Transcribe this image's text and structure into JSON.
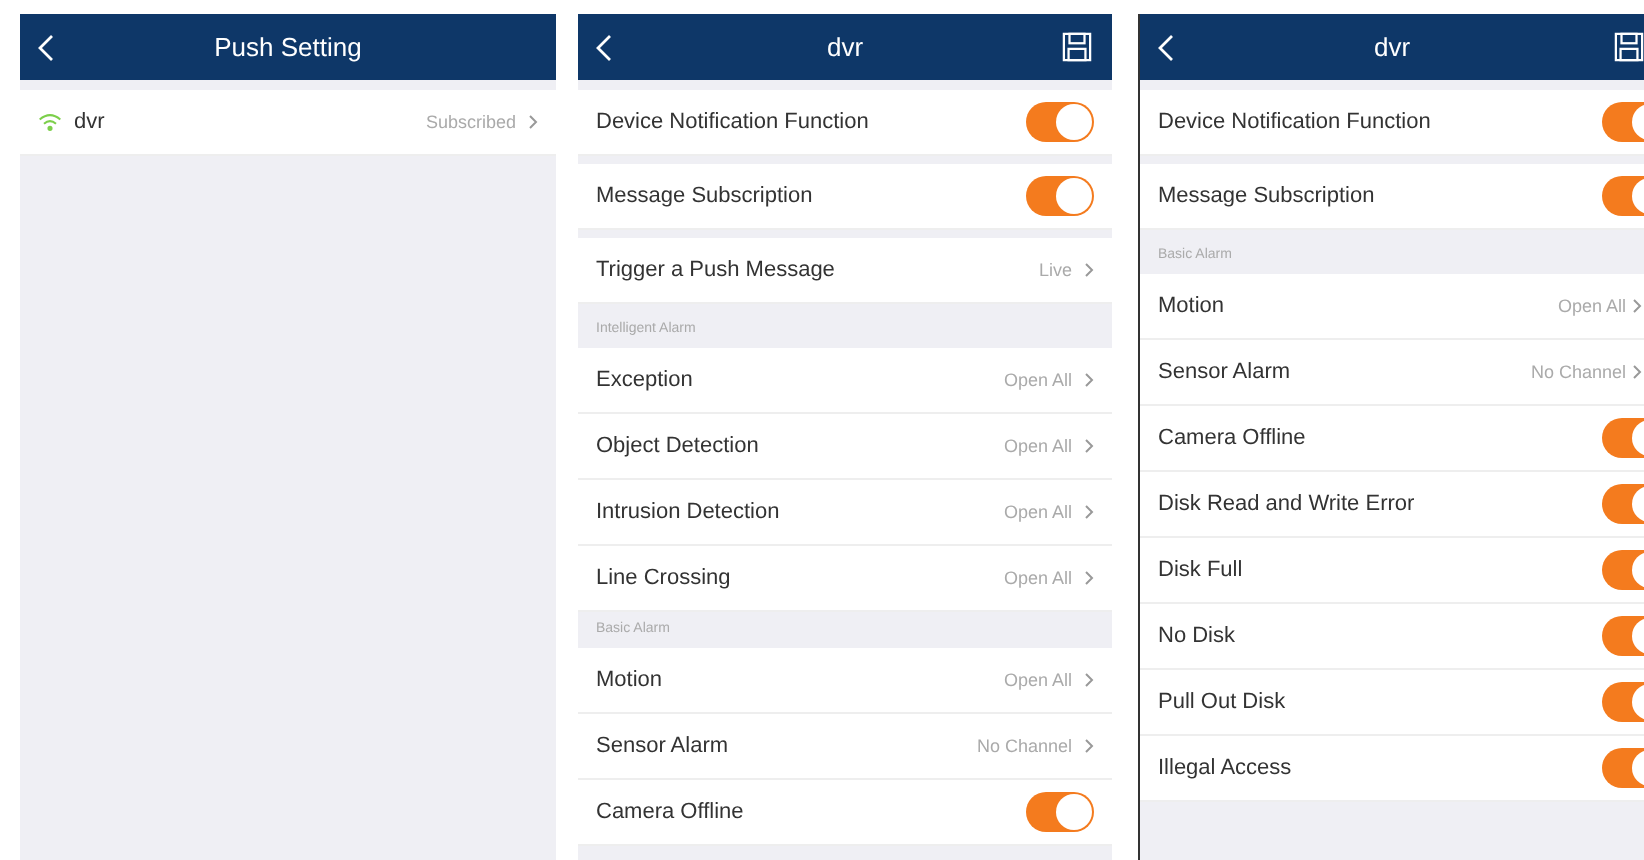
{
  "panels": [
    {
      "title": "Push Setting",
      "save": false,
      "sections": [
        {
          "rows": [
            {
              "kind": "device",
              "label": "dvr",
              "value": "Subscribed"
            }
          ]
        }
      ]
    },
    {
      "title": "dvr",
      "save": true,
      "sections": [
        {
          "rows": [
            {
              "kind": "toggle",
              "label": "Device Notification Function",
              "on": true
            }
          ]
        },
        {
          "rows": [
            {
              "kind": "toggle",
              "label": "Message Subscription",
              "on": true
            }
          ]
        },
        {
          "rows": [
            {
              "kind": "link",
              "label": "Trigger a Push Message",
              "value": "Live"
            }
          ]
        },
        {
          "header": "Intelligent Alarm",
          "rows": [
            {
              "kind": "link",
              "label": "Exception",
              "value": "Open All"
            },
            {
              "kind": "link",
              "label": "Object Detection",
              "value": "Open All"
            },
            {
              "kind": "link",
              "label": "Intrusion Detection",
              "value": "Open All"
            },
            {
              "kind": "link",
              "label": "Line Crossing",
              "value": "Open All"
            }
          ]
        },
        {
          "header": "Basic Alarm",
          "rows": [
            {
              "kind": "link",
              "label": "Motion",
              "value": "Open All"
            },
            {
              "kind": "link",
              "label": "Sensor Alarm",
              "value": "No Channel"
            },
            {
              "kind": "toggle",
              "label": "Camera Offline",
              "on": true
            }
          ]
        }
      ]
    },
    {
      "title": "dvr",
      "save": true,
      "sections": [
        {
          "rows": [
            {
              "kind": "toggle",
              "label": "Device Notification Function",
              "on": true
            }
          ]
        },
        {
          "rows": [
            {
              "kind": "toggle",
              "label": "Message Subscription",
              "on": true
            }
          ]
        },
        {
          "header": "Basic Alarm",
          "rows": [
            {
              "kind": "link",
              "label": "Motion",
              "value": "Open All"
            },
            {
              "kind": "link",
              "label": "Sensor Alarm",
              "value": "No Channel"
            },
            {
              "kind": "toggle",
              "label": "Camera Offline",
              "on": true
            },
            {
              "kind": "toggle",
              "label": "Disk Read and Write Error",
              "on": true
            },
            {
              "kind": "toggle",
              "label": "Disk Full",
              "on": true
            },
            {
              "kind": "toggle",
              "label": "No Disk",
              "on": true
            },
            {
              "kind": "toggle",
              "label": "Pull Out Disk",
              "on": true
            },
            {
              "kind": "toggle",
              "label": "Illegal Access",
              "on": true
            }
          ]
        }
      ]
    }
  ]
}
